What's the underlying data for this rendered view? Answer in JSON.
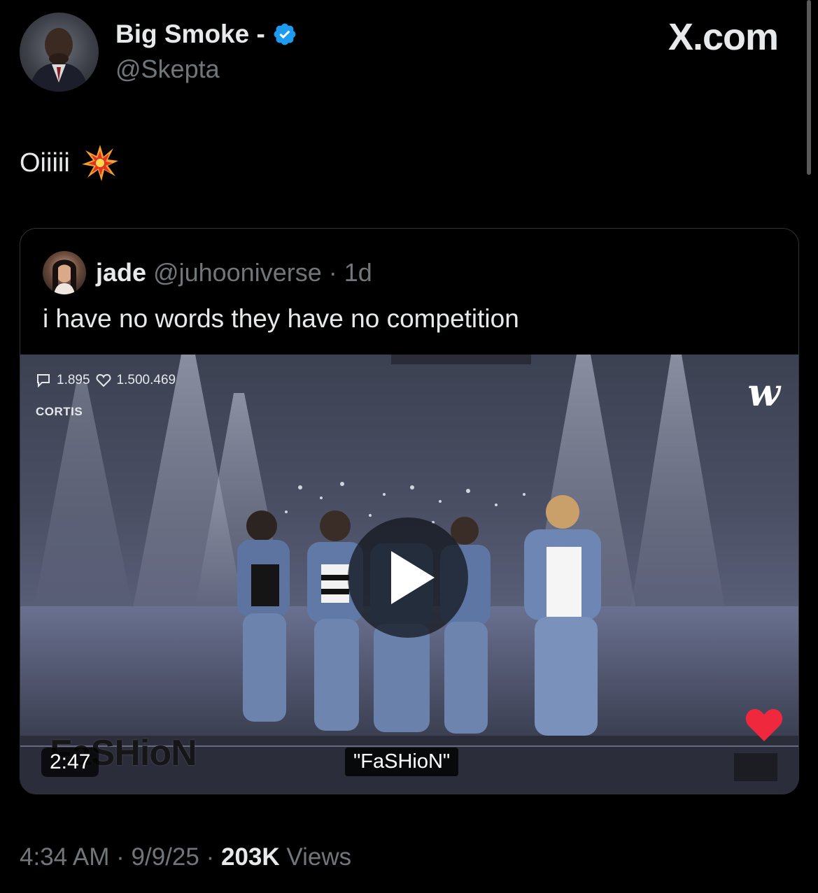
{
  "author": {
    "display_name": "Big Smoke -",
    "handle": "@Skepta",
    "verified": true,
    "verified_color": "#1d9bf0"
  },
  "brand": "X.com",
  "tweet": {
    "text": "Oiiiii",
    "emoji": "collision"
  },
  "quote": {
    "name": "jade",
    "handle": "@juhooniverse",
    "separator": "·",
    "age": "1d",
    "text": "i have no words they have no competition",
    "video": {
      "comments": "1.895",
      "likes": "1.500.469",
      "channel_label": "CORTIS",
      "watermark": "w",
      "song_overlay": "FaSHioN",
      "duration": "2:47",
      "caption": "\"FaSHioN\""
    }
  },
  "footer": {
    "time": "4:34 AM",
    "dot": "·",
    "date": "9/9/25",
    "views_count": "203K",
    "views_label": "Views"
  },
  "colors": {
    "background": "#000000",
    "text_primary": "#e7e9ea",
    "text_secondary": "#71767b",
    "border": "#2f3336"
  }
}
